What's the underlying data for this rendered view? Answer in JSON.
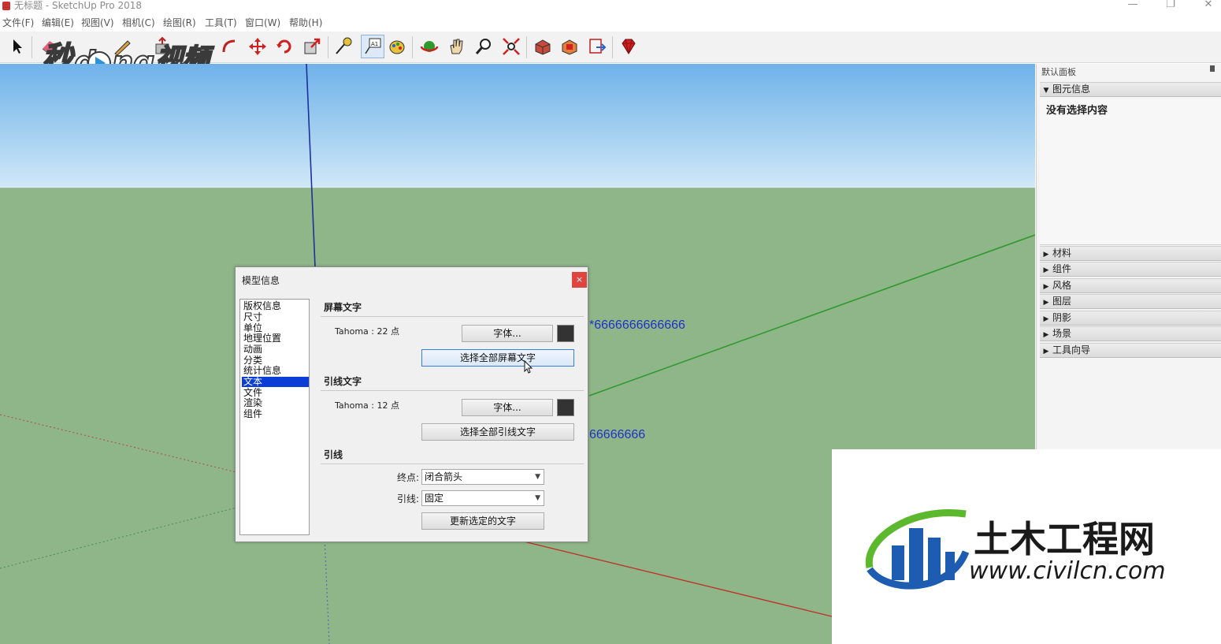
{
  "window": {
    "title": "无标题 - SketchUp Pro 2018",
    "minimize_glyph": "—",
    "restore_glyph": "❐",
    "close_glyph": "✕"
  },
  "menu": [
    "文件(F)",
    "编辑(E)",
    "视图(V)",
    "相机(C)",
    "绘图(R)",
    "工具(T)",
    "窗口(W)",
    "帮助(H)"
  ],
  "toolbar_icons": [
    "select-arrow-icon",
    "eraser-icon",
    "line-pencil-icon",
    "paint-bucket-icon",
    "push-pull-icon",
    "offset-icon",
    "move-icon",
    "rotate-icon",
    "scale-icon",
    "tape-measure-icon",
    "text-tool-icon",
    "paint-icon",
    "orbit-icon",
    "pan-hand-icon",
    "zoom-magnifier-icon",
    "zoom-extents-icon",
    "3d-warehouse-icon",
    "extension-warehouse-icon",
    "layout-icon",
    "ruby-icon"
  ],
  "watermark_text": "秒dong视频",
  "scene": {
    "screen_text": "*6666666666666",
    "leader_text": "66666666"
  },
  "tray": {
    "title": "默认面板",
    "entity_info": {
      "label": "图元信息",
      "arrow": "▼",
      "empty_text": "没有选择内容"
    },
    "collapsed_arrow": "▶",
    "sections": [
      "材料",
      "组件",
      "风格",
      "图层",
      "阴影",
      "场景",
      "工具向导"
    ]
  },
  "dialog": {
    "title": "模型信息",
    "close_glyph": "×",
    "categories": [
      "版权信息",
      "尺寸",
      "单位",
      "地理位置",
      "动画",
      "分类",
      "统计信息",
      "文本",
      "文件",
      "渲染",
      "组件"
    ],
    "selected_category": "文本",
    "screen_text_section": {
      "title": "屏幕文字",
      "font_info": "Tahoma : 22 点",
      "font_button": "字体...",
      "select_all_button": "选择全部屏幕文字",
      "color": "#333333"
    },
    "leader_text_section": {
      "title": "引线文字",
      "font_info": "Tahoma : 12 点",
      "font_button": "字体...",
      "select_all_button": "选择全部引线文字",
      "color": "#333333"
    },
    "leader_section": {
      "title": "引线",
      "endpoint_label": "终点:",
      "endpoint_value": "闭合箭头",
      "leader_label": "引线:",
      "leader_value": "固定",
      "update_button": "更新选定的文字"
    }
  },
  "civil_logo": {
    "title": "土木工程网",
    "url": "www.civilcn.com"
  },
  "colors": {
    "sky_top": "#6fb2ea",
    "ground": "#8fb689",
    "axis_blue": "#1d2f9a",
    "axis_green": "#2e9a2e",
    "axis_red": "#c0302a",
    "selection": "#0a3ed6",
    "annotation_text": "#2030c8"
  }
}
